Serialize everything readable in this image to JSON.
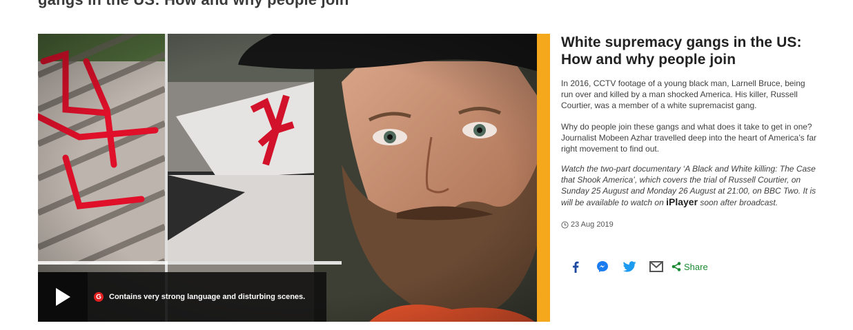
{
  "colors": {
    "accent": "#f5a81c",
    "guidance_badge": "#e02020",
    "facebook": "#1d4aa0",
    "messenger": "#1b7cf0",
    "twitter": "#1d9bf0",
    "email": "#555555",
    "share": "#1b8a32"
  },
  "top_cut_text": "gangs in the US: How and why people join",
  "media": {
    "guidance_badge": "G",
    "guidance_text": "Contains very strong language and disturbing scenes."
  },
  "article": {
    "headline": "White supremacy gangs in the US: How and why people join",
    "paragraph1": "In 2016, CCTV footage of a young black man, Larnell Bruce, being run over and killed by a man shocked America. His killer, Russell Courtier, was a member of a white supremacist gang.",
    "paragraph2": "Why do people join these gangs and what does it take to get in one? Journalist Mobeen Azhar travelled deep into the heart of America’s far right movement to find out.",
    "paragraph3_before": "Watch the two-part documentary ‘A Black and White killing: The Case that Shook America’, which covers the trial of Russell Courtier, on Sunday 25 August and Monday 26 August at 21:00, on BBC Two. It is will be available to watch on ",
    "paragraph3_link": "iPlayer",
    "paragraph3_after": " soon after broadcast.",
    "date": "23 Aug 2019"
  },
  "share": {
    "icons": [
      "facebook-icon",
      "messenger-icon",
      "twitter-icon",
      "email-icon"
    ],
    "label": "Share"
  }
}
